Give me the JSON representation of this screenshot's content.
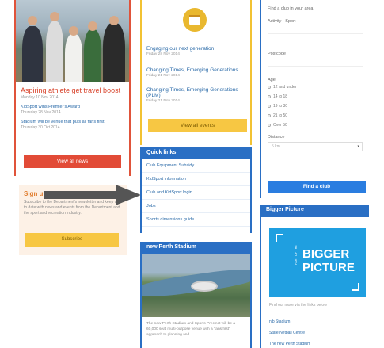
{
  "news": {
    "headline": "Aspiring athlete get travel boost",
    "headline_date": "Monday 10 Nov 2014",
    "items": [
      {
        "title": "KidSport wins Premier's Award",
        "date": "Thursday 28 Nov 2014"
      },
      {
        "title": "Stadium will be venue that puts all fans first",
        "date": "Thursday 30 Oct 2014"
      }
    ],
    "button": "View all news"
  },
  "signup": {
    "title": "Sign u",
    "text": "Subscribe to the Department's newsletter and keep up to date with news and events from the Department and the sport and recreation industry.",
    "button": "Subscribe"
  },
  "events": {
    "items": [
      {
        "title": "Engaging our next generation",
        "date": "Friday 28 Nov 2014"
      },
      {
        "title": "Changing Times, Emerging Generations",
        "date": "Friday 21 Nov 2014"
      },
      {
        "title": "Changing Times, Emerging Generations (PLM)",
        "date": "Friday 21 Nov 2014"
      }
    ],
    "button": "View all events"
  },
  "quicklinks": {
    "title": "Quick links",
    "items": [
      "Club Equipment Subsidy",
      "KidSport information",
      "Club and KidSport login",
      "Jobs",
      "Sports dimensions guide"
    ]
  },
  "stadium": {
    "title": "new Perth Stadium",
    "text": "The new Perth Stadium and Sports Precinct will be a 60,000 seat multi-purpose venue with a 'fans first' approach to planning and"
  },
  "club_finder": {
    "intro": "Find a club in your area",
    "activity_label": "Activity - Sport",
    "postcode_label": "Postcode",
    "age_label": "Age",
    "age_options": [
      "12 and under",
      "14 to 18",
      "19 to 30",
      "21 to 50",
      "Over 50"
    ],
    "distance_label": "Distance",
    "distance_value": "5 km",
    "button": "Find a club"
  },
  "bigger_picture": {
    "title": "Bigger Picture",
    "logo_side": "PART OF THE",
    "logo_line1": "BIGGER",
    "logo_line2": "PICTURE",
    "text": "Find out more via the links below",
    "links": [
      "nib Stadium",
      "State Netball Centre",
      "The new Perth Stadium"
    ]
  }
}
